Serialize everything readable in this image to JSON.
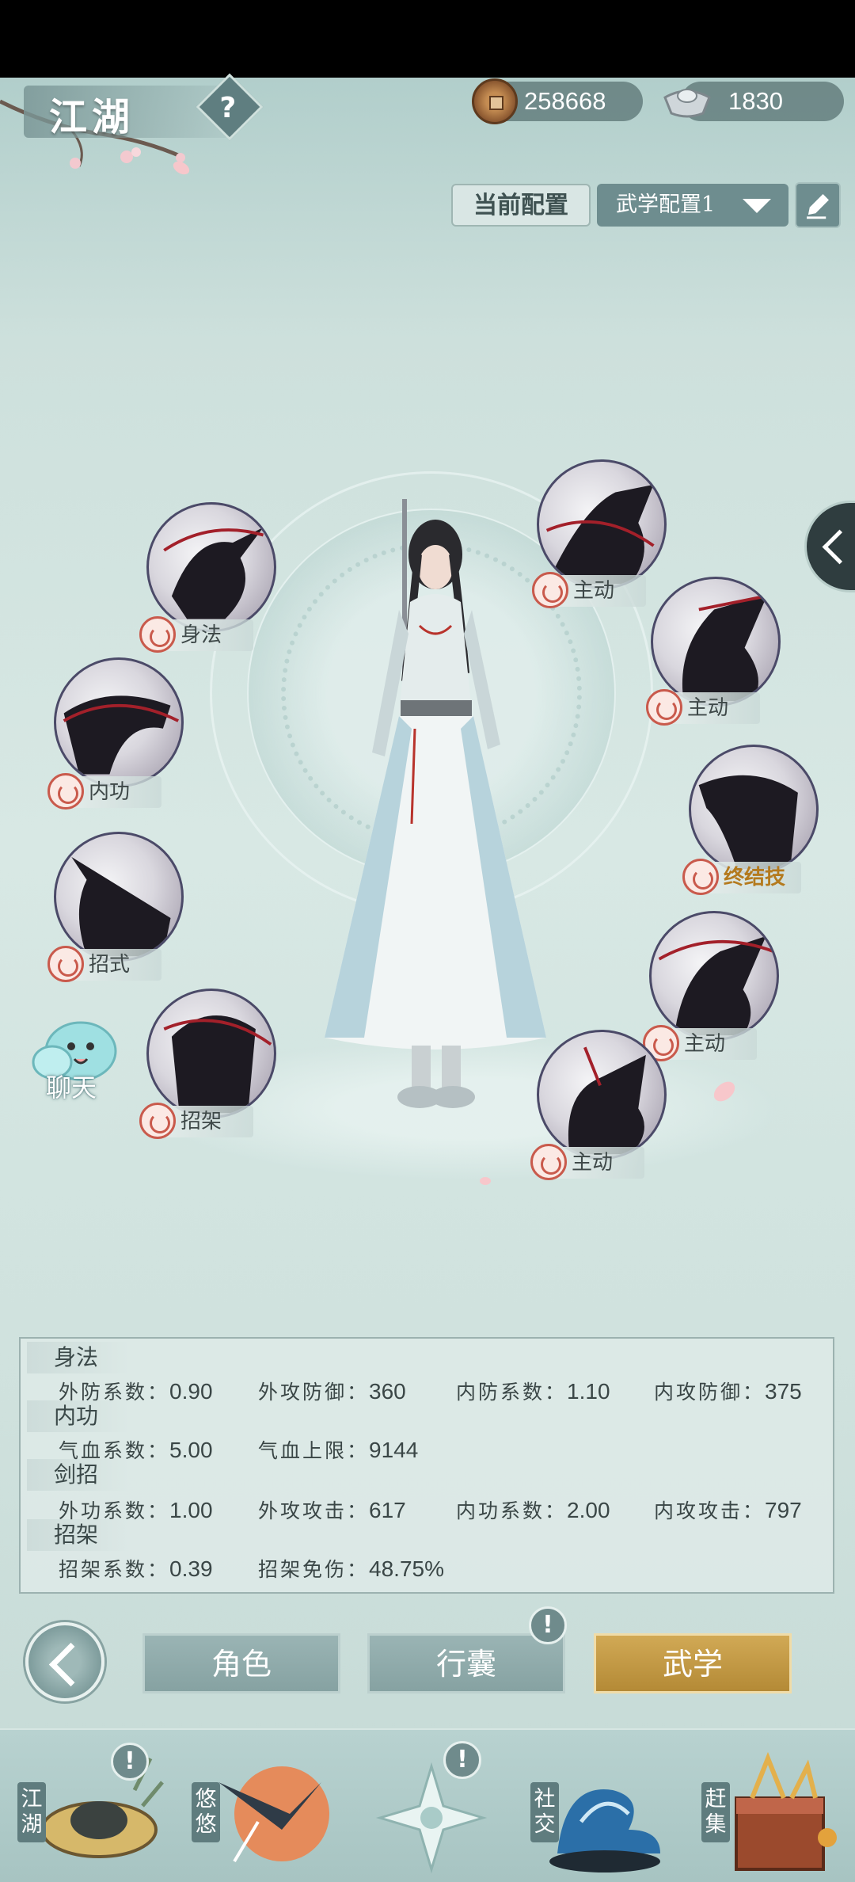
{
  "header": {
    "title": "江湖",
    "help_icon": "question-icon",
    "currencies": [
      {
        "icon": "copper-coin-icon",
        "amount": "258668"
      },
      {
        "icon": "silver-ingot-icon",
        "amount": "1830"
      }
    ]
  },
  "config": {
    "label": "当前配置",
    "selected": "武学配置1",
    "edit_icon": "pencil-icon"
  },
  "skills": {
    "left": [
      {
        "label": "身法"
      },
      {
        "label": "内功"
      },
      {
        "label": "招式"
      },
      {
        "label": "招架"
      }
    ],
    "right": [
      {
        "label": "主动"
      },
      {
        "label": "主动"
      },
      {
        "label": "终结技"
      },
      {
        "label": "主动"
      },
      {
        "label": "主动"
      }
    ]
  },
  "chat": {
    "label": "聊天"
  },
  "stats": {
    "sections": [
      {
        "title": "身法",
        "items": [
          {
            "key": "外防系数",
            "value": "0.90"
          },
          {
            "key": "外攻防御",
            "value": "360"
          },
          {
            "key": "内防系数",
            "value": "1.10"
          },
          {
            "key": "内攻防御",
            "value": "375"
          }
        ]
      },
      {
        "title": "内功",
        "items": [
          {
            "key": "气血系数",
            "value": "5.00"
          },
          {
            "key": "气血上限",
            "value": "9144"
          }
        ]
      },
      {
        "title": "剑招",
        "items": [
          {
            "key": "外功系数",
            "value": "1.00"
          },
          {
            "key": "外攻攻击",
            "value": "617"
          },
          {
            "key": "内功系数",
            "value": "2.00"
          },
          {
            "key": "内攻攻击",
            "value": "797"
          }
        ]
      },
      {
        "title": "招架",
        "items": [
          {
            "key": "招架系数",
            "value": "0.39"
          },
          {
            "key": "招架免伤",
            "value": "48.75%"
          }
        ]
      }
    ]
  },
  "tabs": [
    {
      "label": "角色",
      "active": false
    },
    {
      "label": "行囊",
      "active": false,
      "badge": "!"
    },
    {
      "label": "武学",
      "active": true
    }
  ],
  "bottom_nav": [
    {
      "label": "江湖",
      "badge": "!"
    },
    {
      "label": "悠悠"
    },
    {
      "label": "",
      "badge": "!"
    },
    {
      "label": "社交"
    },
    {
      "label": "赶集"
    }
  ],
  "colors": {
    "background": "#cde0dc",
    "active_tab": "#c49a46",
    "inactive_tab": "#8fabab",
    "seal_red": "#c95a4c",
    "final_skill_gold": "#b47a1e"
  }
}
